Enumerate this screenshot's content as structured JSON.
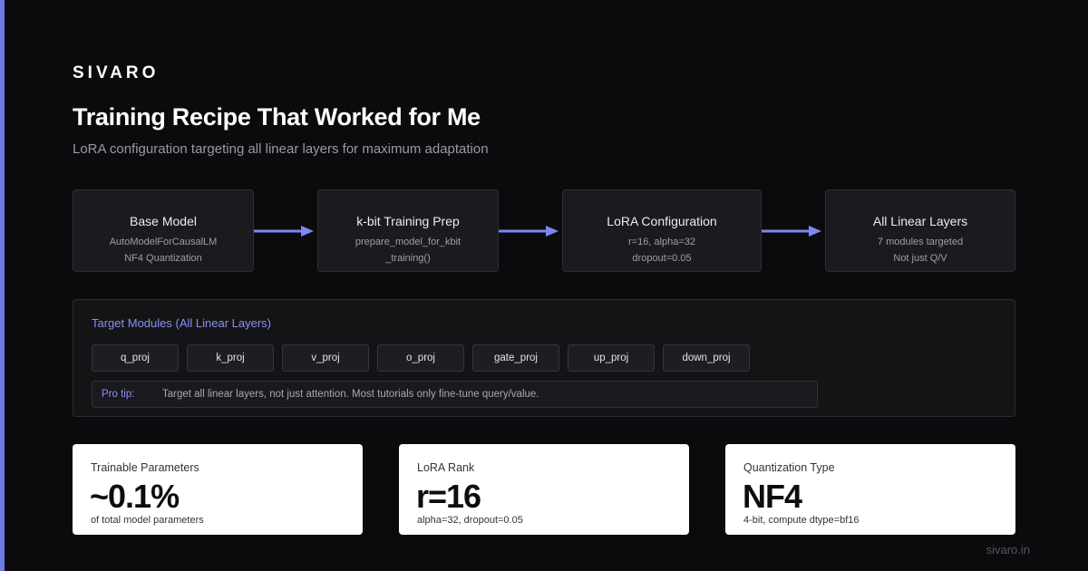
{
  "brand": "SIVARO",
  "title": "Training Recipe That Worked for Me",
  "subtitle": "LoRA configuration targeting all linear layers for maximum adaptation",
  "flow": [
    {
      "title": "Base Model",
      "lines": [
        "AutoModelForCausalLM",
        "NF4 Quantization"
      ]
    },
    {
      "title": "k-bit Training Prep",
      "lines": [
        "prepare_model_for_kbit",
        "_training()"
      ]
    },
    {
      "title": "LoRA Configuration",
      "lines": [
        "r=16, alpha=32",
        "dropout=0.05"
      ]
    },
    {
      "title": "All Linear Layers",
      "lines": [
        "7 modules targeted",
        "Not just Q/V"
      ]
    }
  ],
  "modules": {
    "title": "Target Modules (All Linear Layers)",
    "items": [
      "q_proj",
      "k_proj",
      "v_proj",
      "o_proj",
      "gate_proj",
      "up_proj",
      "down_proj"
    ],
    "tip_label": "Pro tip:",
    "tip_text": "Target all linear layers, not just attention. Most tutorials only fine-tune query/value."
  },
  "stats": [
    {
      "label": "Trainable Parameters",
      "value": "~0.1%",
      "note": "of total model parameters"
    },
    {
      "label": "LoRA Rank",
      "value": "r=16",
      "note": "alpha=32, dropout=0.05"
    },
    {
      "label": "Quantization Type",
      "value": "NF4",
      "note": "4-bit, compute dtype=bf16"
    }
  ],
  "footer": "sivaro.in",
  "colors": {
    "background": "#0b0b0e",
    "accent": "#7079e8",
    "arrow": "#7f86f2",
    "box": "#1b1b1f",
    "stat_card": "#ffffff"
  }
}
